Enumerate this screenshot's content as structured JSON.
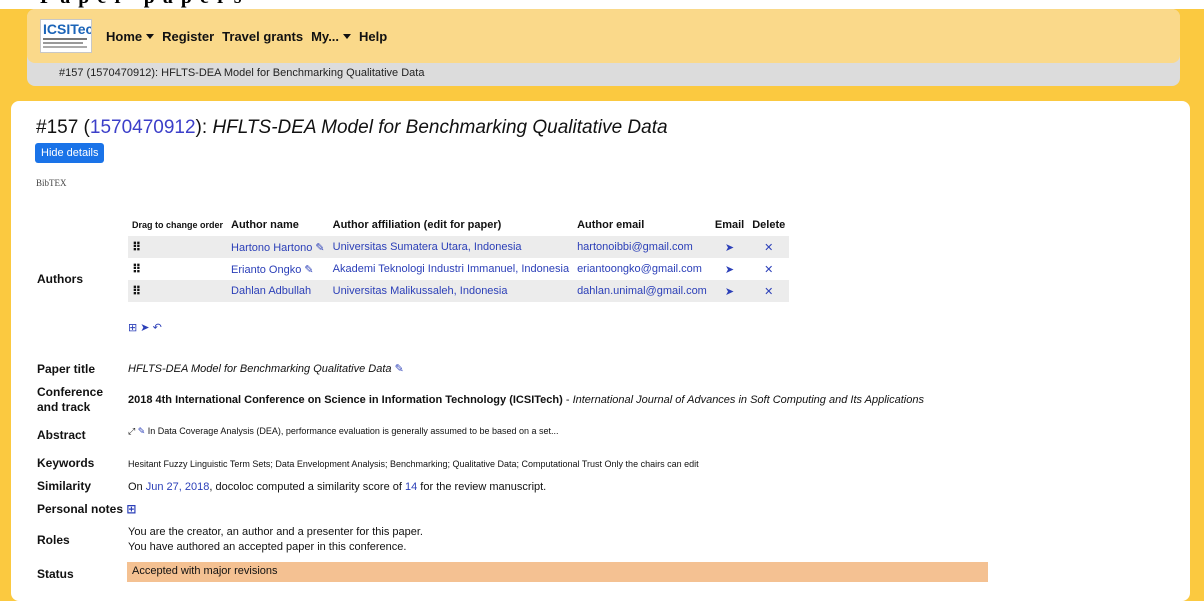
{
  "header": {
    "brand": "ICSITech",
    "nav": [
      {
        "label": "Home",
        "dropdown": true
      },
      {
        "label": "Register",
        "dropdown": false
      },
      {
        "label": "Travel grants",
        "dropdown": false
      },
      {
        "label": "My...",
        "dropdown": true
      },
      {
        "label": "Help",
        "dropdown": false
      }
    ],
    "breadcrumb": "#157 (1570470912): HFLTS-DEA Model for Benchmarking Qualitative Data"
  },
  "paper": {
    "number": "#157 (",
    "id": "1570470912",
    "sep": "): ",
    "title": "HFLTS-DEA Model for Benchmarking Qualitative Data",
    "hide_details": "Hide details",
    "bibtex": "BibTEX"
  },
  "authors": {
    "label": "Authors",
    "columns": [
      "Drag to change order",
      "Author name",
      "Author affiliation (edit for paper)",
      "Author email",
      "Email",
      "Delete"
    ],
    "rows": [
      {
        "name": "Hartono Hartono",
        "affiliation": "Universitas Sumatera Utara, Indonesia",
        "email": "hartonoibbi@gmail.com",
        "editable": true
      },
      {
        "name": "Erianto Ongko",
        "affiliation": "Akademi Teknologi Industri Immanuel, Indonesia",
        "email": "eriantoongko@gmail.com",
        "editable": true
      },
      {
        "name": "Dahlan Adbullah",
        "affiliation": "Universitas Malikussaleh, Indonesia",
        "email": "dahlan.unimal@gmail.com",
        "editable": false
      }
    ]
  },
  "fields": {
    "paper_title_label": "Paper title",
    "paper_title": "HFLTS-DEA Model for Benchmarking Qualitative Data",
    "conference_label_1": "Conference",
    "conference_label_2": "and track",
    "conference": "2018 4th International Conference on Science in Information Technology (ICSITech)",
    "track_sep": " - ",
    "track": "International Journal of Advances in Soft Computing and Its Applications",
    "abstract_label": "Abstract",
    "abstract": "In Data Coverage Analysis (DEA), performance evaluation is generally assumed to be based on a set...",
    "keywords_label": "Keywords",
    "keywords": "Hesitant Fuzzy Linguistic Term Sets; Data Envelopment Analysis; Benchmarking; Qualitative Data; Computational Trust Only the chairs can edit",
    "similarity_label": "Similarity",
    "similarity_pre": "On ",
    "similarity_date": "Jun 27, 2018",
    "similarity_mid": ", docoloc computed a similarity score of ",
    "similarity_score": "14",
    "similarity_post": " for the review manuscript.",
    "notes_label": "Personal notes",
    "roles_label": "Roles",
    "roles_1": "You are the creator, an author and a presenter for this paper.",
    "roles_2": "You have authored an accepted paper in this conference.",
    "status_label": "Status",
    "status": "Accepted with major revisions"
  },
  "colors": {
    "page_bg": "#fbc940",
    "navbar": "#fad98a",
    "link": "#2b3fb8",
    "button": "#1a73e8",
    "status_bg": "#f4c192"
  }
}
